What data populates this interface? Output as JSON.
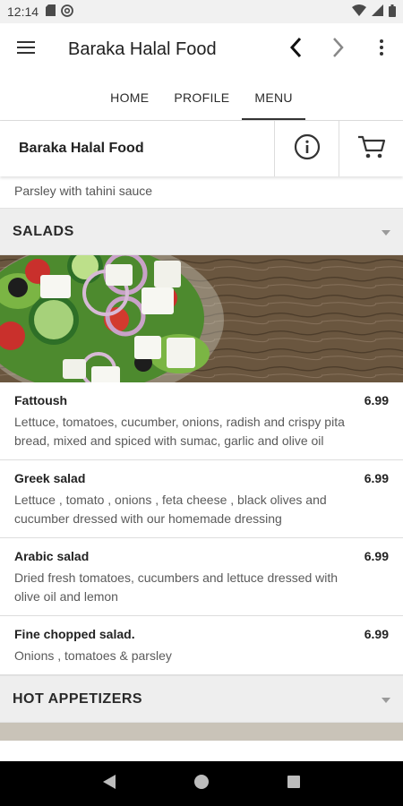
{
  "status_bar": {
    "time": "12:14"
  },
  "app_bar": {
    "title": "Baraka Halal Food"
  },
  "tabs": [
    {
      "label": "HOME",
      "active": false
    },
    {
      "label": "PROFILE",
      "active": false
    },
    {
      "label": "MENU",
      "active": true
    }
  ],
  "restaurant": {
    "name": "Baraka Halal Food"
  },
  "previous_item_desc": "Parsley with tahini sauce",
  "sections": [
    {
      "title": "SALADS",
      "items": [
        {
          "name": "Fattoush",
          "price": "6.99",
          "desc": "Lettuce, tomatoes, cucumber, onions, radish and crispy pita bread, mixed and spiced with sumac, garlic and olive oil"
        },
        {
          "name": "Greek salad",
          "price": "6.99",
          "desc": "Lettuce , tomato , onions , feta cheese , black olives and cucumber dressed with our homemade dressing"
        },
        {
          "name": "Arabic salad",
          "price": "6.99",
          "desc": "Dried fresh tomatoes, cucumbers and lettuce dressed with olive oil and lemon"
        },
        {
          "name": "Fine chopped salad.",
          "price": "6.99",
          "desc": "Onions , tomatoes & parsley"
        }
      ]
    },
    {
      "title": "HOT APPETIZERS",
      "items": []
    }
  ],
  "icons": {
    "menu": "hamburger-menu-icon",
    "back": "chevron-left-icon",
    "forward": "chevron-right-icon",
    "more": "more-vert-icon",
    "info": "info-icon",
    "cart": "cart-icon",
    "dropdown": "caret-down-icon"
  }
}
